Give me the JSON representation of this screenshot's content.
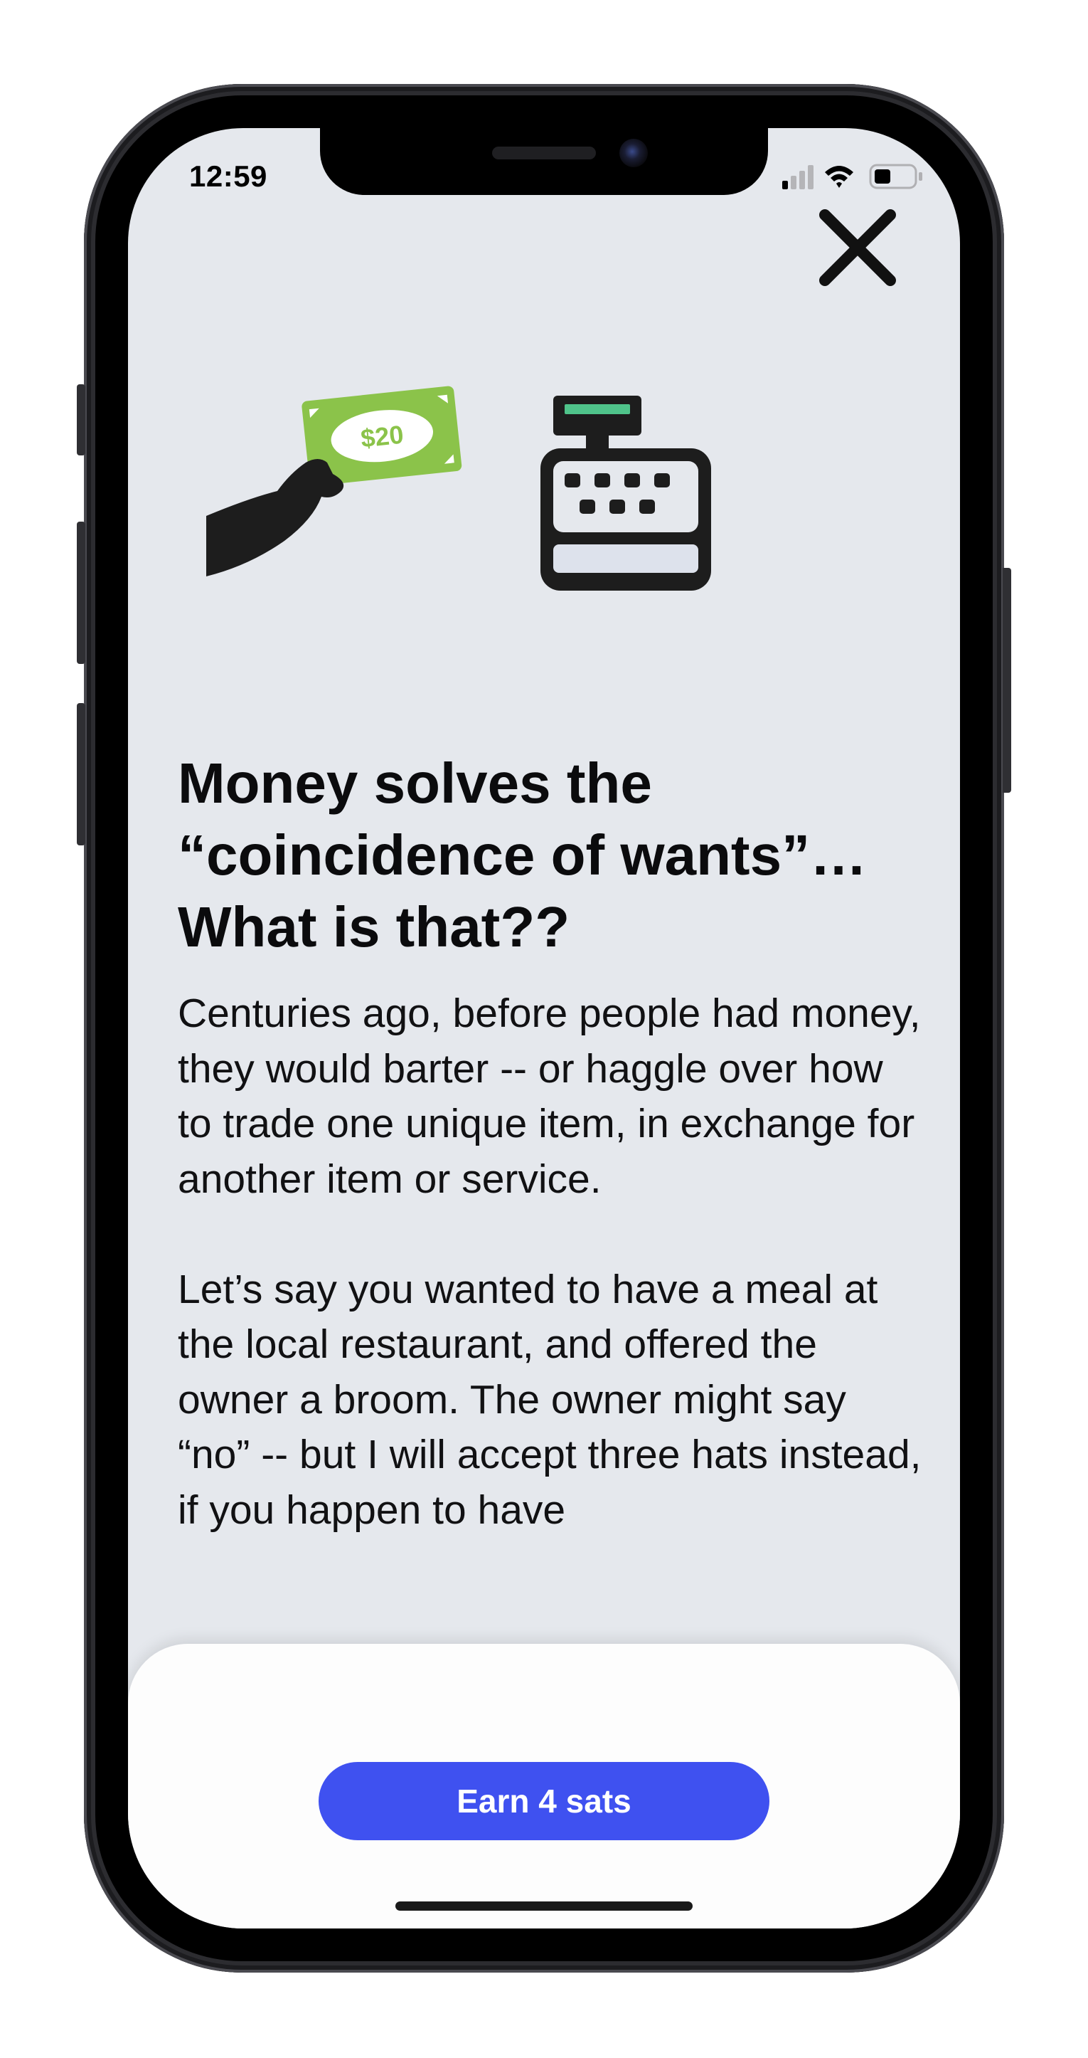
{
  "status_bar": {
    "time": "12:59"
  },
  "close": {
    "icon": "close-icon"
  },
  "illustration": {
    "bill_label": "$20",
    "bill_color": "#8bc34a",
    "register_accent": "#4fc38a"
  },
  "lesson": {
    "title": "Money solves the “coincidence of wants”… What is that??",
    "paragraphs": [
      "Centuries ago, before people had money, they would barter -- or haggle over how to trade one unique item, in exchange for another item or service.",
      "Let’s say you wanted to have a meal at the local restaurant, and offered the owner a broom. The owner might say “no” -- but I will accept three hats instead, if you happen to have"
    ]
  },
  "footer": {
    "earn_button_label": "Earn 4 sats",
    "accent": "#3f51f0"
  }
}
